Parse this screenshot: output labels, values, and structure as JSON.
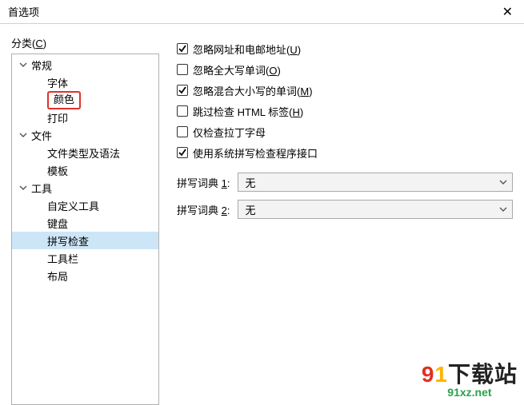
{
  "window": {
    "title": "首选项",
    "close_glyph": "✕"
  },
  "category": {
    "label_prefix": "分类(",
    "label_key": "C",
    "label_suffix": ")"
  },
  "tree": {
    "general": {
      "label": "常规"
    },
    "font": {
      "label": "字体"
    },
    "color": {
      "label": "颜色"
    },
    "print": {
      "label": "打印"
    },
    "file": {
      "label": "文件"
    },
    "filetypes": {
      "label": "文件类型及语法"
    },
    "template": {
      "label": "模板"
    },
    "tools": {
      "label": "工具"
    },
    "customtools": {
      "label": "自定义工具"
    },
    "keyboard": {
      "label": "键盘"
    },
    "spellcheck": {
      "label": "拼写检查"
    },
    "toolbar": {
      "label": "工具栏"
    },
    "layout": {
      "label": "布局"
    }
  },
  "options": {
    "ignore_url": {
      "text_pre": "忽略网址和电邮地址(",
      "key": "U",
      "text_post": ")",
      "checked": true
    },
    "ignore_upper": {
      "text_pre": "忽略全大写单词(",
      "key": "O",
      "text_post": ")",
      "checked": false
    },
    "ignore_mixed": {
      "text_pre": "忽略混合大小写的单词(",
      "key": "M",
      "text_post": ")",
      "checked": true
    },
    "skip_html": {
      "text_pre": "跳过检查 HTML 标签(",
      "key": "H",
      "text_post": ")",
      "checked": false
    },
    "latin_only": {
      "text_pre": "仅检查拉丁字母",
      "key": "",
      "text_post": "",
      "checked": false
    },
    "use_system": {
      "text_pre": "使用系统拼写检查程序接口",
      "key": "",
      "text_post": "",
      "checked": true
    }
  },
  "dicts": {
    "d1": {
      "label_pre": "拼写词典 ",
      "label_key": "1",
      "label_post": ":",
      "value": "无"
    },
    "d2": {
      "label_pre": "拼写词典 ",
      "label_key": "2",
      "label_post": ":",
      "value": "无"
    }
  },
  "watermark": {
    "nine": "9",
    "one": "1",
    "rest": "下载站",
    "sub": "91xz.net"
  }
}
